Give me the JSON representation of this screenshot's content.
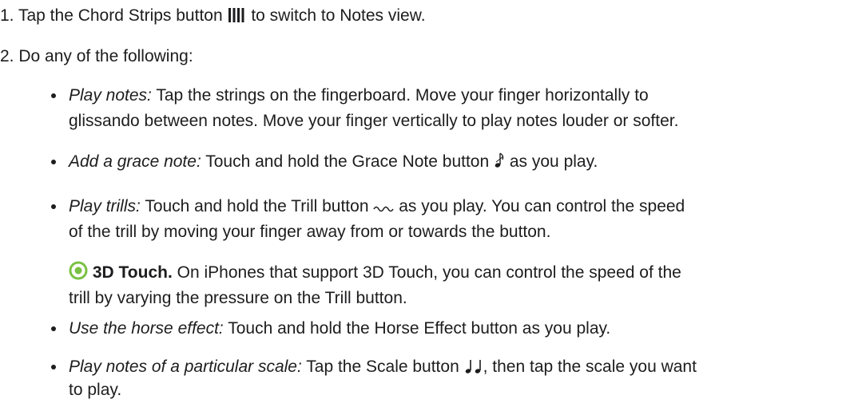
{
  "steps": [
    {
      "num": "1.",
      "before": "Tap the Chord Strips button",
      "after": " to switch to Notes view."
    },
    {
      "num": "2.",
      "text": "Do any of the following:"
    }
  ],
  "bullets": [
    {
      "term": "Play notes:",
      "lines": [
        " Tap the strings on the fingerboard. Move your finger horizontally to",
        "glissando between notes. Move your finger vertically to play notes louder or softer."
      ]
    },
    {
      "term": "Add a grace note:",
      "before": " Touch and hold the Grace Note button",
      "after": " as you play."
    },
    {
      "term": "Play trills:",
      "before": " Touch and hold the Trill button",
      "after": " as you play. You can control the speed",
      "line2": "of the trill by moving your finger away from or towards the button."
    },
    {
      "term": "Use the horse effect:",
      "text": " Touch and hold the Horse Effect button as you play."
    },
    {
      "term": "Play notes of a particular scale:",
      "before": " Tap the Scale button",
      "after": ", then tap the scale you want",
      "line2": "to play."
    }
  ],
  "note": {
    "label": "3D Touch.",
    "line1": " On iPhones that support 3D Touch, you can control the speed of the",
    "line2": "trill by varying the pressure on the Trill button."
  },
  "colors": {
    "accent": "#7ac143",
    "text": "#1d1d1f"
  },
  "icons": [
    "chord-strips-icon",
    "grace-note-icon",
    "trill-icon",
    "3d-touch-icon",
    "scale-icon"
  ]
}
